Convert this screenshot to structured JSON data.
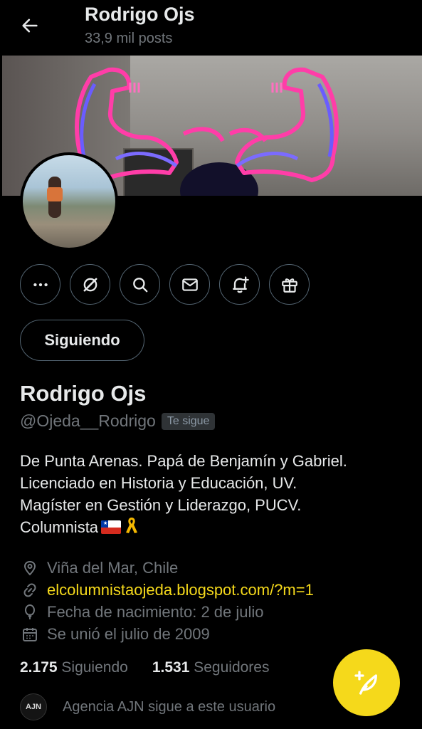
{
  "header": {
    "title": "Rodrigo Ojs",
    "posts": "33,9 mil posts"
  },
  "actions": {
    "following_label": "Siguiendo"
  },
  "profile": {
    "name": "Rodrigo Ojs",
    "handle": "@Ojeda__Rodrigo",
    "follows_you": "Te sigue",
    "bio_lines": [
      "De Punta Arenas. Papá de Benjamín y Gabriel.",
      "Licenciado en Historia y Educación, UV.",
      "Magíster en Gestión y Liderazgo, PUCV.",
      "Columnista"
    ],
    "location": "Viña del Mar, Chile",
    "website": "elcolumnistaojeda.blogspot.com/?m=1",
    "birthday": "Fecha de nacimiento: 2 de julio",
    "joined": "Se unió el julio de 2009"
  },
  "stats": {
    "following_count": "2.175",
    "following_label": "Siguiendo",
    "followers_count": "1.531",
    "followers_label": "Seguidores"
  },
  "followed_by": {
    "avatar_text": "AJN",
    "text": "Agencia AJN sigue a este usuario"
  },
  "colors": {
    "accent": "#f5d91b",
    "muted": "#71767b",
    "border": "#536471"
  }
}
